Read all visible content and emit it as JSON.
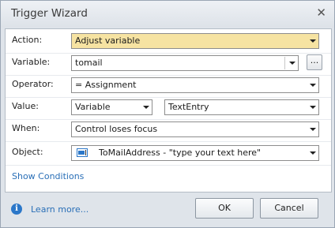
{
  "window": {
    "title": "Trigger Wizard"
  },
  "fields": {
    "action": {
      "label": "Action:",
      "value": "Adjust variable"
    },
    "variable": {
      "label": "Variable:",
      "value": "tomail",
      "browse_label": "..."
    },
    "operator": {
      "label": "Operator:",
      "value": "= Assignment"
    },
    "value": {
      "label": "Value:",
      "type_value": "Variable",
      "value": "TextEntry"
    },
    "when": {
      "label": "When:",
      "value": "Control loses focus"
    },
    "object": {
      "label": "Object:",
      "value": "ToMailAddress - \"type your text here\""
    }
  },
  "show_conditions": "Show Conditions",
  "footer": {
    "learn_more": "Learn more...",
    "ok": "OK",
    "cancel": "Cancel"
  },
  "colors": {
    "highlight": "#f6e3a2",
    "link": "#2a6fb7",
    "info_icon": "#2b77c9"
  }
}
